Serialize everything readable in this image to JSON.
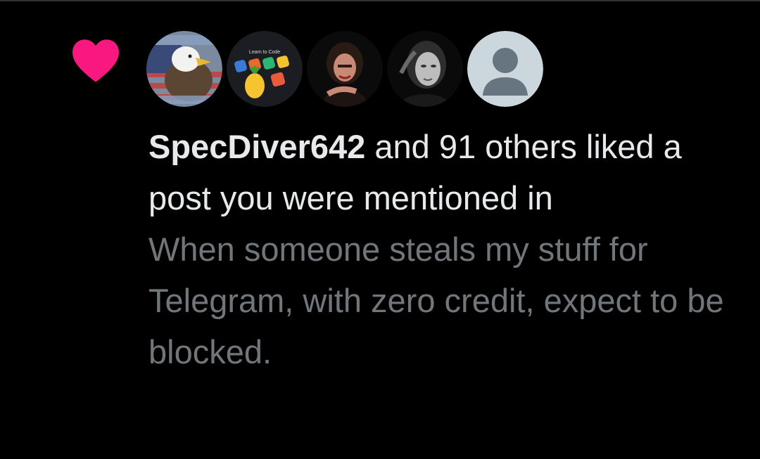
{
  "notification": {
    "type_icon": "heart-icon",
    "accent_color": "#f91880",
    "avatars": [
      {
        "name": "eagle-flag-avatar"
      },
      {
        "name": "learn-to-code-avatar",
        "caption": "Learn to Code"
      },
      {
        "name": "woman-portrait-avatar"
      },
      {
        "name": "bw-woman-portrait-avatar"
      },
      {
        "name": "default-profile-avatar"
      }
    ],
    "username": "SpecDiver642",
    "summary_text": " and 91 others liked a post you were mentioned in",
    "post_preview": "When someone steals my stuff for Telegram, with zero credit, expect to be blocked.",
    "text_color": "#e7e9ea",
    "secondary_text_color": "#71767b"
  }
}
